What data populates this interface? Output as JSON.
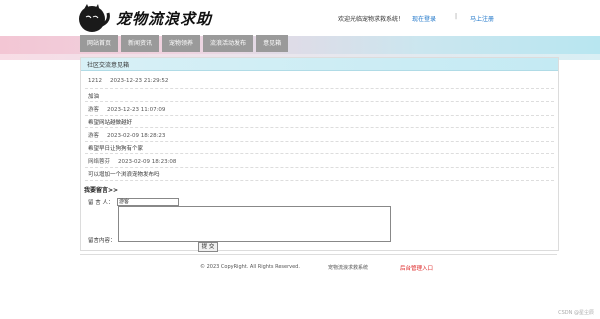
{
  "header": {
    "logo_text": "宠物流浪求助",
    "welcome": "欢迎光临宠物求救系统！",
    "login_link": "现在登录",
    "register_link": "马上注册"
  },
  "nav": {
    "items": [
      {
        "label": "网站首页"
      },
      {
        "label": "新闻资讯"
      },
      {
        "label": "宠物领养"
      },
      {
        "label": "流浪活动发布"
      },
      {
        "label": "意见箱"
      }
    ]
  },
  "board": {
    "title": "社区交流意见箱",
    "entries": [
      {
        "user": "1212",
        "time": "2023-12-23 21:29:52",
        "content": "加油"
      },
      {
        "user": "游客",
        "time": "2023-12-23 11:07:09",
        "content": "希望网站越做越好"
      },
      {
        "user": "游客",
        "time": "2023-02-09 18:28:23",
        "content": "希望早日让狗狗有个家"
      },
      {
        "user": "网络蓉芬",
        "time": "2023-02-09 18:23:08",
        "content": "可以增加一个浏浪宠物发布吗"
      }
    ]
  },
  "form": {
    "title": "我要留言>>",
    "name_label": "留  言  人：",
    "name_value": "游客",
    "content_label": "留言内容：",
    "submit_label": "提 交"
  },
  "footer": {
    "copyright": "© 2023 CopyRight. All Rights Reserved.",
    "system_name": "宠物流浪求救系统",
    "admin_link": "后台管理入口"
  },
  "watermark": "CSDN @星尘辰"
}
